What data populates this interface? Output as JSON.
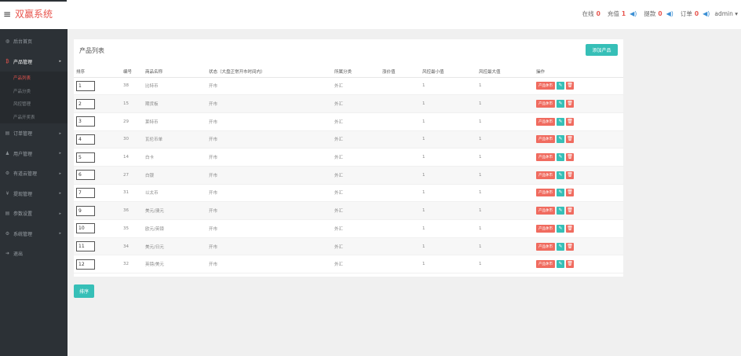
{
  "header": {
    "brand": "双赢系统",
    "stats": [
      {
        "label": "在线",
        "count": "0"
      },
      {
        "label": "充值",
        "count": "1"
      },
      {
        "label": "提款",
        "count": "0"
      },
      {
        "label": "订单",
        "count": "0"
      }
    ],
    "user": "admin ▾"
  },
  "sidebar": {
    "items": [
      {
        "label": "后台首页",
        "icon": "dashboard-icon",
        "glyph": "◍",
        "caret": ""
      },
      {
        "label": "产品管理",
        "icon": "bitcoin-icon",
        "glyph": "₿",
        "caret": "▸",
        "active": true
      },
      {
        "label": "订单管理",
        "icon": "list-icon",
        "glyph": "▤",
        "caret": "▸"
      },
      {
        "label": "用户管理",
        "icon": "user-icon",
        "glyph": "♟",
        "caret": "▸"
      },
      {
        "label": "有道云管理",
        "icon": "settings-icon",
        "glyph": "⚙",
        "caret": "▸"
      },
      {
        "label": "提现管理",
        "icon": "yen-icon",
        "glyph": "¥",
        "caret": "▸"
      },
      {
        "label": "参数设置",
        "icon": "list-icon",
        "glyph": "▤",
        "caret": "▸"
      },
      {
        "label": "系统管理",
        "icon": "gears-icon",
        "glyph": "⚙",
        "caret": "▸"
      },
      {
        "label": "退出",
        "icon": "logout-icon",
        "glyph": "➜",
        "caret": ""
      }
    ],
    "sub_items": [
      "产品列表",
      "产品分类",
      "风控管理",
      "产品开奖表"
    ]
  },
  "main": {
    "title": "产品列表",
    "add_label": "添加产品",
    "sort_label": "排序",
    "columns": [
      "排序",
      "编号",
      "商品名称",
      "状态（大盘正常开市时间内）",
      "所属分类",
      "涨价值",
      "风控最小值",
      "风控最大值",
      "操作"
    ],
    "rows": [
      {
        "sort": "1",
        "id": "38",
        "name": "比特币",
        "status": "开市",
        "category": "外汇",
        "rise": "",
        "min": "1",
        "max": "1"
      },
      {
        "sort": "2",
        "id": "15",
        "name": "期货板",
        "status": "开市",
        "category": "外汇",
        "rise": "",
        "min": "1",
        "max": "1"
      },
      {
        "sort": "3",
        "id": "29",
        "name": "莱特币",
        "status": "开市",
        "category": "外汇",
        "rise": "",
        "min": "1",
        "max": "1"
      },
      {
        "sort": "4",
        "id": "30",
        "name": "瓦伦币单",
        "status": "开市",
        "category": "外汇",
        "rise": "",
        "min": "1",
        "max": "1"
      },
      {
        "sort": "5",
        "id": "14",
        "name": "白卡",
        "status": "开市",
        "category": "外汇",
        "rise": "",
        "min": "1",
        "max": "1"
      },
      {
        "sort": "6",
        "id": "27",
        "name": "白银",
        "status": "开市",
        "category": "外汇",
        "rise": "",
        "min": "1",
        "max": "1"
      },
      {
        "sort": "7",
        "id": "31",
        "name": "以太币",
        "status": "开市",
        "category": "外汇",
        "rise": "",
        "min": "1",
        "max": "1"
      },
      {
        "sort": "9",
        "id": "36",
        "name": "美元/澳元",
        "status": "开市",
        "category": "外汇",
        "rise": "",
        "min": "1",
        "max": "1"
      },
      {
        "sort": "10",
        "id": "35",
        "name": "欧元/英镑",
        "status": "开市",
        "category": "外汇",
        "rise": "",
        "min": "1",
        "max": "1"
      },
      {
        "sort": "11",
        "id": "34",
        "name": "美元/日元",
        "status": "开市",
        "category": "外汇",
        "rise": "",
        "min": "1",
        "max": "1"
      },
      {
        "sort": "12",
        "id": "32",
        "name": "英镑/美元",
        "status": "开市",
        "category": "外汇",
        "rise": "",
        "min": "1",
        "max": "1"
      }
    ],
    "row_action_label": "产品休市",
    "edit_glyph": "✎",
    "delete_glyph": "🗑"
  },
  "colors": {
    "accent": "#e8554e",
    "teal": "#36bfb7",
    "sidebar": "#2c3136"
  }
}
